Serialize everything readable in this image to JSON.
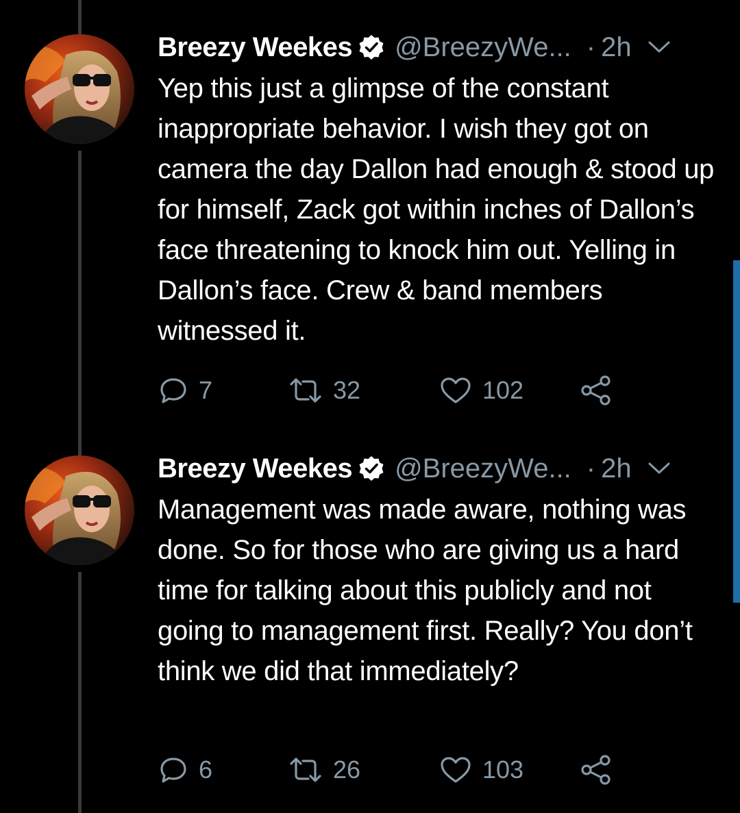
{
  "colors": {
    "background": "#000000",
    "text": "#ffffff",
    "secondary": "#8899a6",
    "thread_line": "#3a3a3a",
    "scroll_indicator": "#1c6fa8"
  },
  "tweets": [
    {
      "display_name": "Breezy Weekes",
      "verified_icon": "verified-badge-icon",
      "handle": "@BreezyWe...",
      "separator": "·",
      "time": "2h",
      "menu_icon": "chevron-down-icon",
      "text": "Yep this just a glimpse of the constant inappropriate behavior. I wish they got on camera the day Dallon had enough & stood up for himself, Zack got within inches of Dallon’s face threatening to knock him out. Yelling in Dallon’s face. Crew & band members witnessed it.",
      "replies": "7",
      "retweets": "32",
      "likes": "102",
      "share_icon": "share-icon"
    },
    {
      "display_name": "Breezy Weekes",
      "verified_icon": "verified-badge-icon",
      "handle": "@BreezyWe...",
      "separator": "·",
      "time": "2h",
      "menu_icon": "chevron-down-icon",
      "text": "Management was made aware, nothing was done. So for those who are giving us a hard time for talking about this publicly and not going to management first. Really? You don’t think we did that immediately?",
      "replies": "6",
      "retweets": "26",
      "likes": "103",
      "share_icon": "share-icon"
    }
  ]
}
